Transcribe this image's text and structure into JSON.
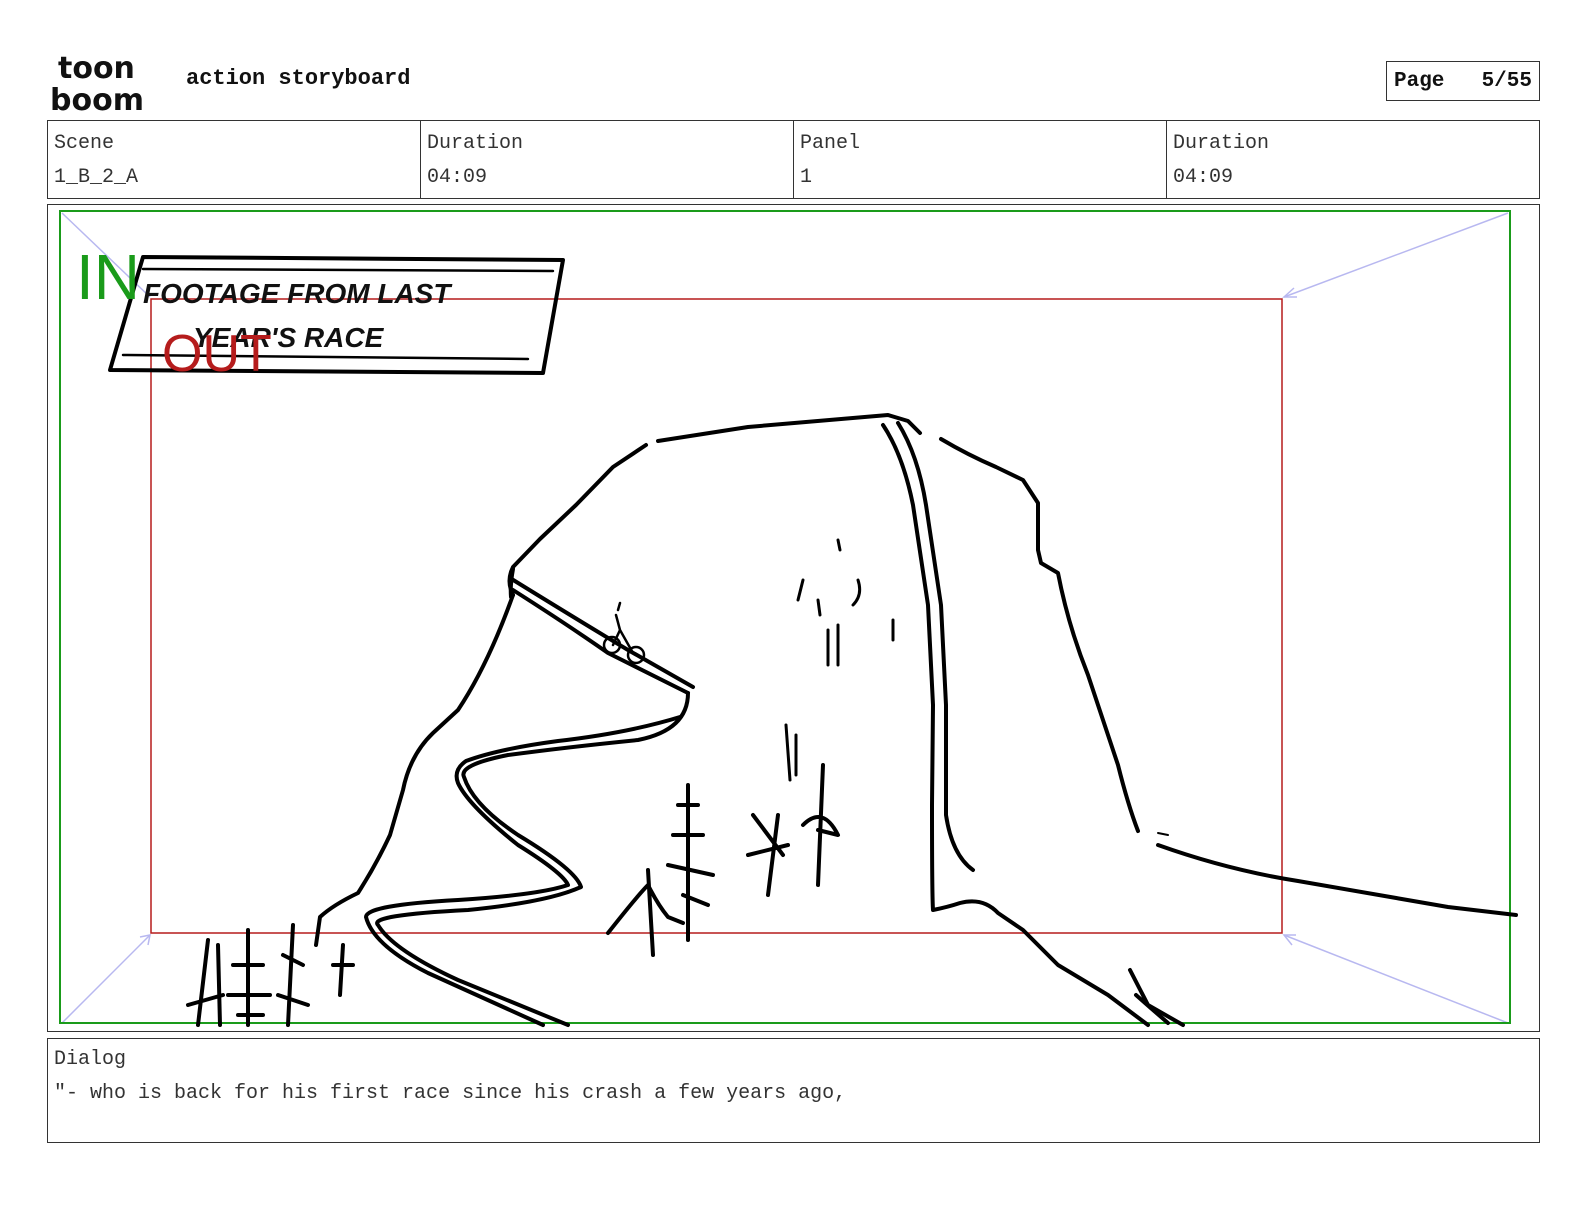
{
  "header": {
    "brand_line1": "toon",
    "brand_line2": "boom",
    "title": "action storyboard",
    "page_label": "Page",
    "page_value": "5/55"
  },
  "info": {
    "scene_label": "Scene",
    "scene_value": "1_B_2_A",
    "duration_label": "Duration",
    "duration_value": "04:09",
    "panel_label": "Panel",
    "panel_value": "1",
    "panel_duration_label": "Duration",
    "panel_duration_value": "04:09"
  },
  "panel": {
    "in_marker": "IN",
    "out_marker": "OUT",
    "caption_line1": "FOOTAGE FROM LAST",
    "caption_line2": "YEAR'S RACE",
    "in_color": "#1a9b1a",
    "out_color": "#b51c1c",
    "arrow_color": "#b8b8f0"
  },
  "dialog": {
    "label": "Dialog",
    "text": "\"- who is back for his first race since his crash a few years ago,"
  }
}
